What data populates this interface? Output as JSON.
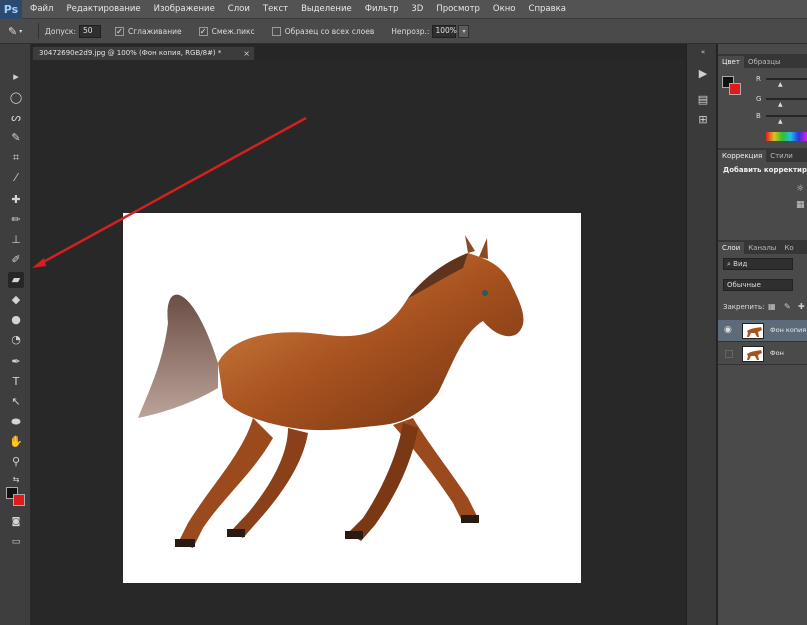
{
  "app": {
    "logo": "Ps",
    "menu": [
      "Файл",
      "Редактирование",
      "Изображение",
      "Слои",
      "Текст",
      "Выделение",
      "Фильтр",
      "3D",
      "Просмотр",
      "Окно",
      "Справка"
    ]
  },
  "options_bar": {
    "tolerance_label": "Допуск:",
    "tolerance_value": "50",
    "antialias_label": "Сглаживание",
    "contiguous_label": "Смеж.пикс",
    "sample_all_label": "Образец со всех слоев",
    "opacity_label": "Непрозр.:",
    "opacity_value": "100%"
  },
  "document": {
    "tab_title": "30472690e2d9.jpg @ 100% (Фон копия, RGB/8#) *",
    "close": "×"
  },
  "panels": {
    "color_tabs": [
      "Цвет",
      "Образцы"
    ],
    "sliders": [
      "R",
      "G",
      "B"
    ],
    "adjust_tabs": [
      "Коррекция",
      "Стили"
    ],
    "adjust_title": "Добавить корректир",
    "layers_tabs": [
      "Слои",
      "Каналы",
      "Ко"
    ],
    "kind_filter": "Вид",
    "blend_mode": "Обычные",
    "lock_label": "Закрепить:",
    "layers": [
      {
        "name": "Фон копия",
        "visible": true,
        "selected": true
      },
      {
        "name": "Фон",
        "visible": false,
        "selected": false
      }
    ]
  },
  "colors": {
    "foreground": "#111111",
    "background": "#e01b1b",
    "annotation_arrow": "#d42020"
  },
  "icons": {
    "tools": [
      "move-icon",
      "marquee-icon",
      "lasso-icon",
      "quick-select-icon",
      "crop-icon",
      "eyedropper-icon",
      "healing-brush-icon",
      "brush-icon",
      "clone-stamp-icon",
      "history-brush-icon",
      "eraser-icon",
      "paint-bucket-icon",
      "blur-icon",
      "dodge-icon",
      "pen-icon",
      "type-icon",
      "path-select-icon",
      "shape-icon",
      "hand-icon",
      "zoom-icon"
    ]
  }
}
